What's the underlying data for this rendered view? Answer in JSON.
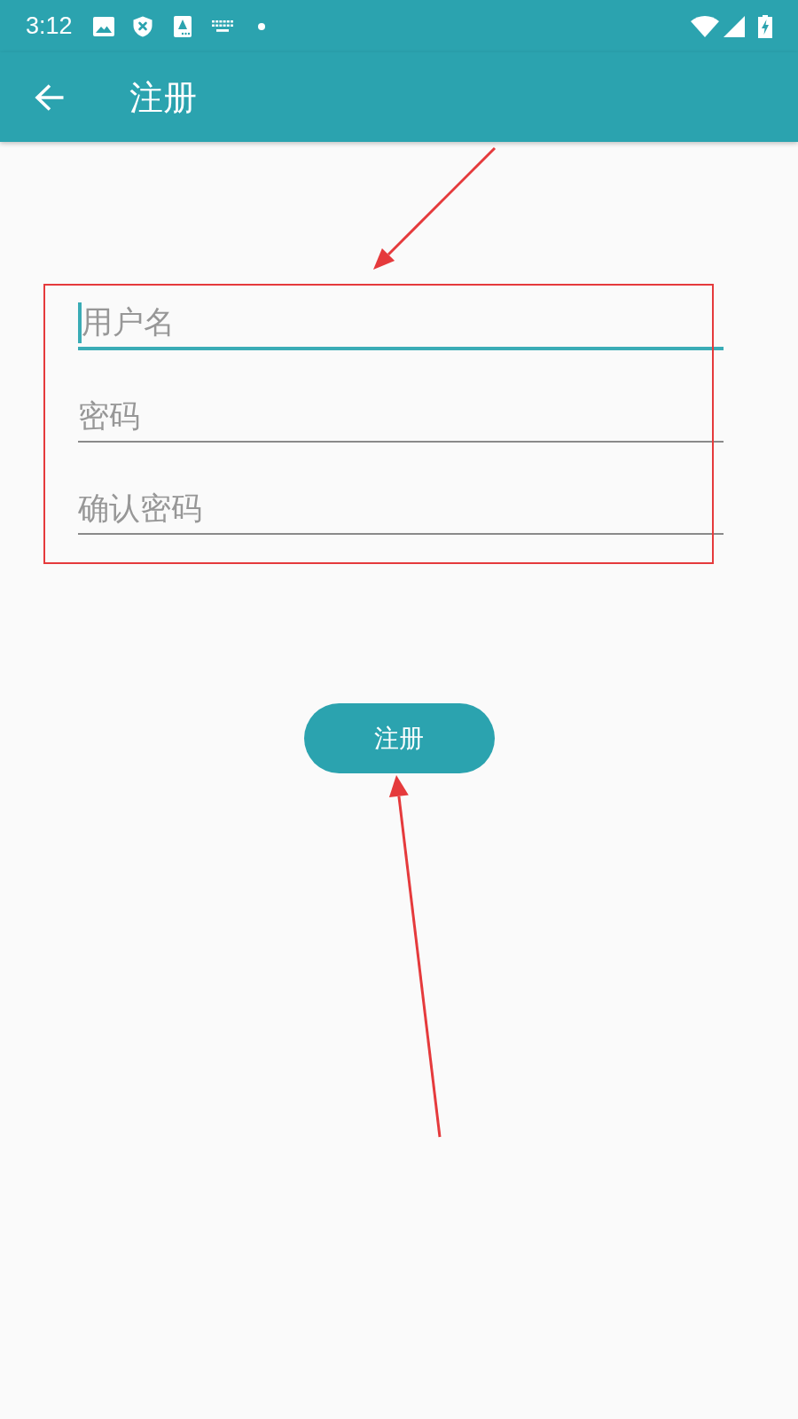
{
  "status_bar": {
    "time": "3:12"
  },
  "app_bar": {
    "title": "注册"
  },
  "form": {
    "highlight_annotation": true,
    "arrow_annotation": true,
    "fields": [
      {
        "placeholder": "用户名",
        "focused": true
      },
      {
        "placeholder": "密码",
        "focused": false
      },
      {
        "placeholder": "确认密码",
        "focused": false
      }
    ]
  },
  "register_button": {
    "label": "注册",
    "arrow_annotation": true
  }
}
